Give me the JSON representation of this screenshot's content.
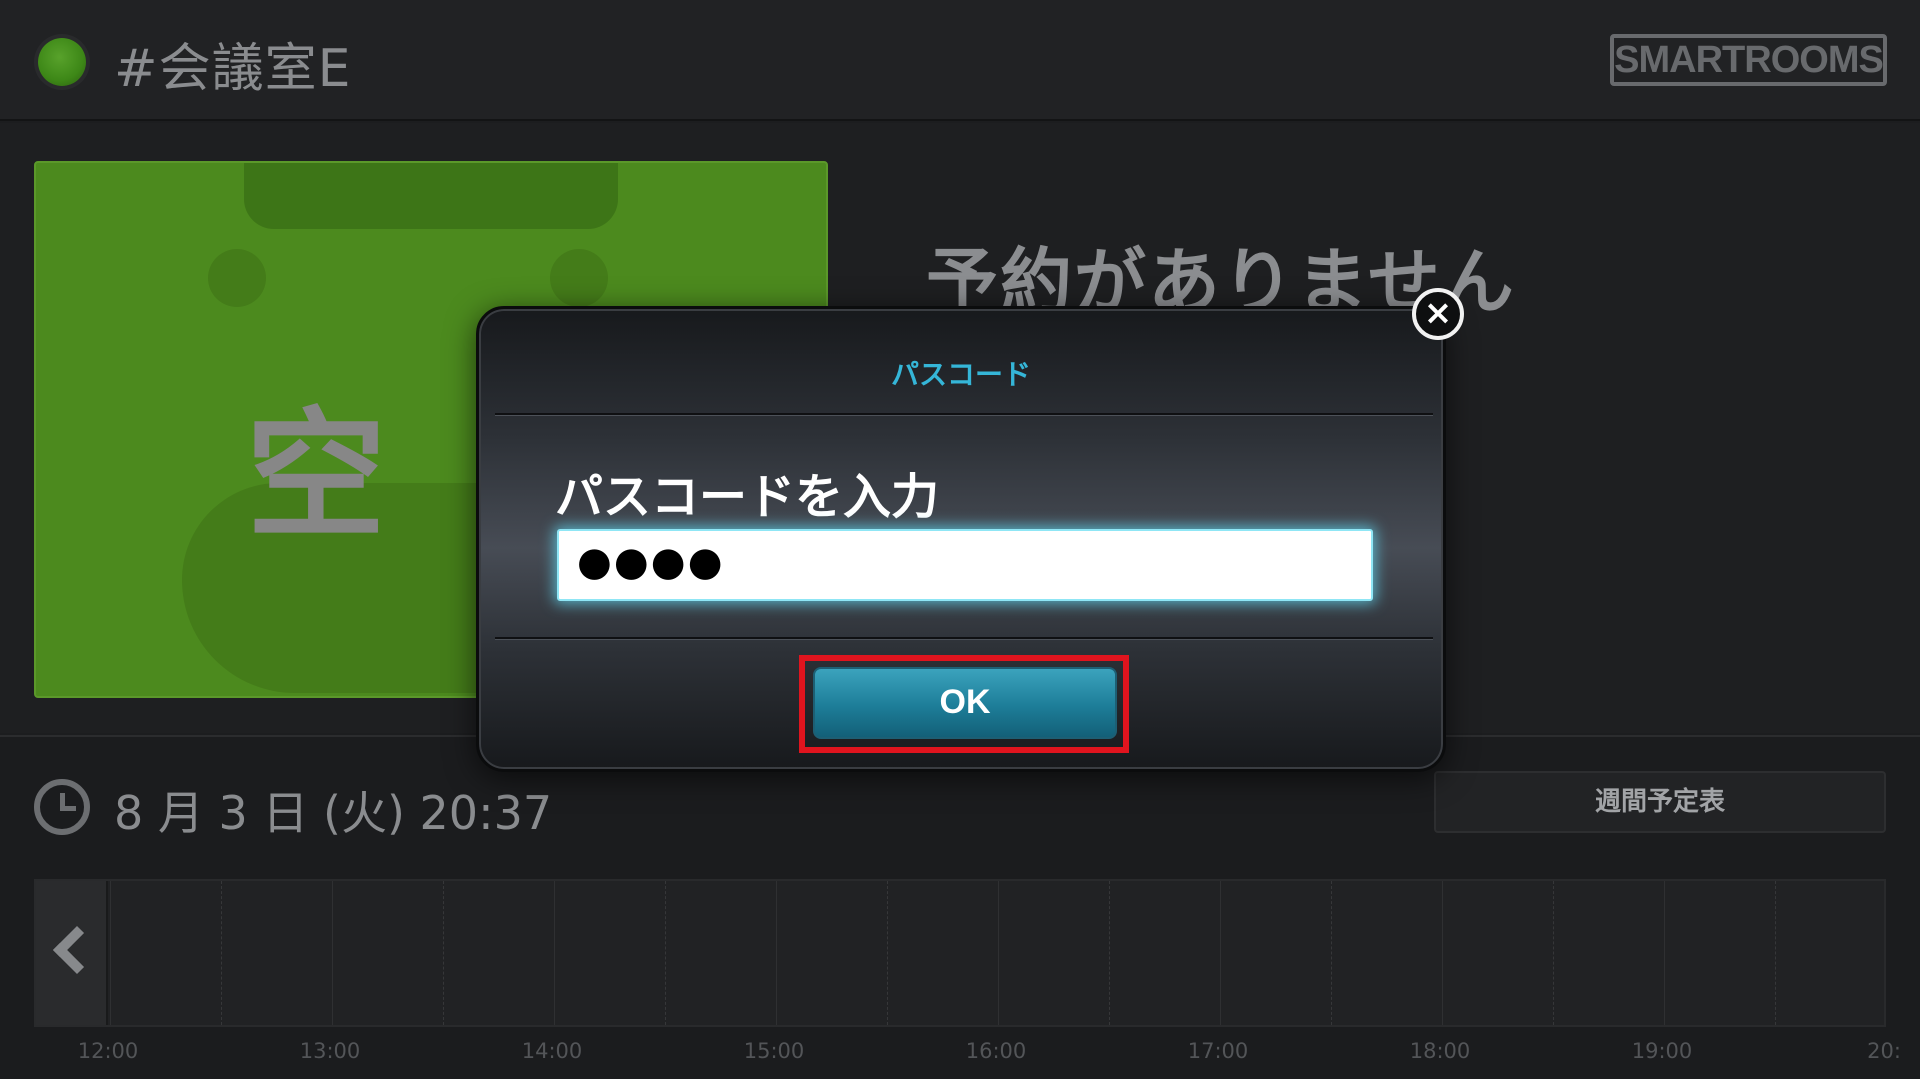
{
  "header": {
    "room_name": "#会議室E",
    "logo_text": "SMARTROOMS",
    "status_color": "#4a981f"
  },
  "status": {
    "vacant_label": "空",
    "no_reservation_text": "予約がありません",
    "card_color": "#4e8d1f"
  },
  "bottom": {
    "datetime": "8 月 3 日 (火)   20:37",
    "weekly_schedule_label": "週間予定表",
    "timeline_ticks": [
      "12:00",
      "13:00",
      "14:00",
      "15:00",
      "16:00",
      "17:00",
      "18:00",
      "19:00",
      "20:"
    ]
  },
  "dialog": {
    "title": "パスコード",
    "prompt": "パスコードを入力",
    "input_value": "●●●●",
    "ok_label": "OK",
    "close_glyph": "×",
    "title_color": "#35b6d8",
    "highlight_color": "#e0141e"
  }
}
